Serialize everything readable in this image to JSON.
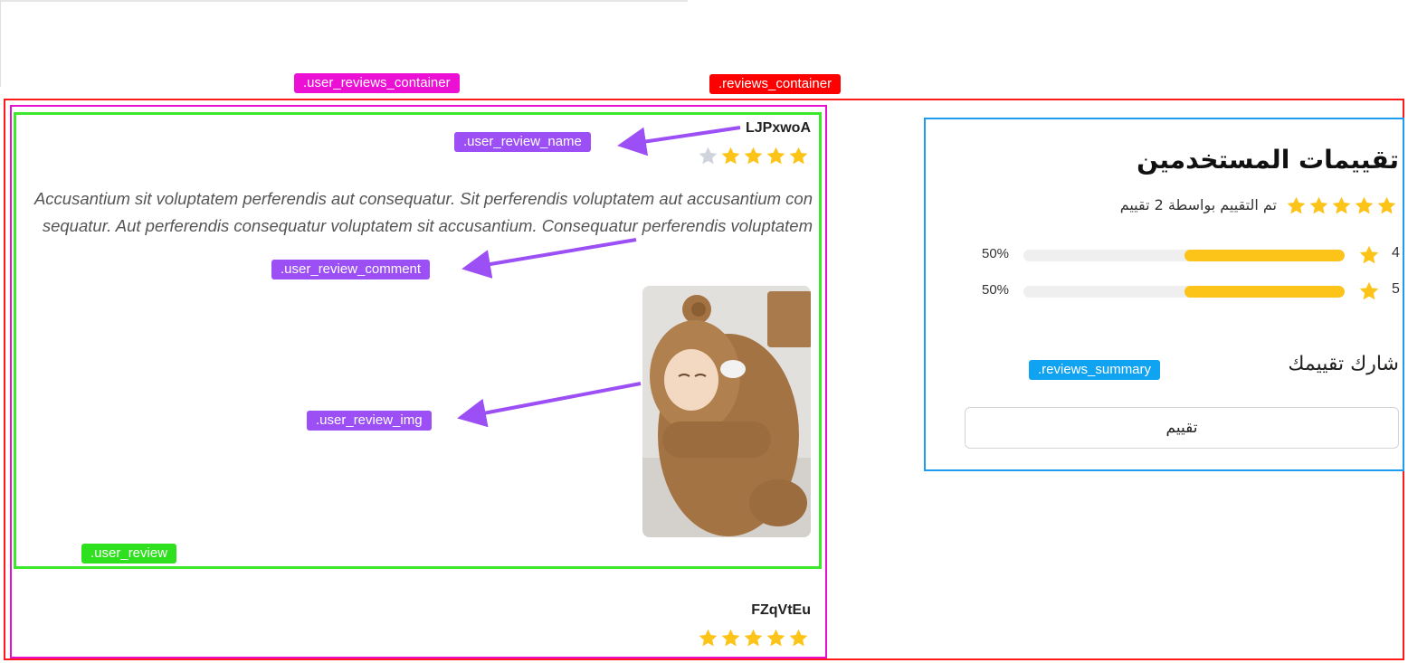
{
  "annotations": {
    "user_reviews_container": ".user_reviews_container",
    "reviews_container": ".reviews_container",
    "user_review_name": ".user_review_name",
    "user_review_comment": ".user_review_comment",
    "user_review_img": ".user_review_img",
    "user_review": ".user_review",
    "reviews_summary": ".reviews_summary"
  },
  "colors": {
    "star_filled": "#fcc419",
    "star_empty": "#cfd4dc",
    "bar_fill": "#fcc419",
    "bar_track": "#efefef"
  },
  "reviews": [
    {
      "name": "LJPxwoA",
      "rating": 4,
      "comment": "Accusantium sit voluptatem perferendis aut consequatur. Sit perferendis voluptatem aut accusantium consequatur. Aut perferendis consequatur voluptatem sit accusantium. Consequatur perferendis voluptatem",
      "image_alt": "baby in brown bear sleeping bag"
    },
    {
      "name": "FZqVtEu",
      "rating": 5
    }
  ],
  "summary": {
    "title": "تقييمات المستخدمين",
    "average_rating": 5,
    "rated_by_text": "تم التقييم بواسطة 2 تقييم",
    "distribution": [
      {
        "stars": "4",
        "percent_label": "50%",
        "fraction": 0.5
      },
      {
        "stars": "5",
        "percent_label": "50%",
        "fraction": 0.5
      }
    ],
    "share_label": "شارك تقييمك",
    "rate_button": "تقييم"
  }
}
